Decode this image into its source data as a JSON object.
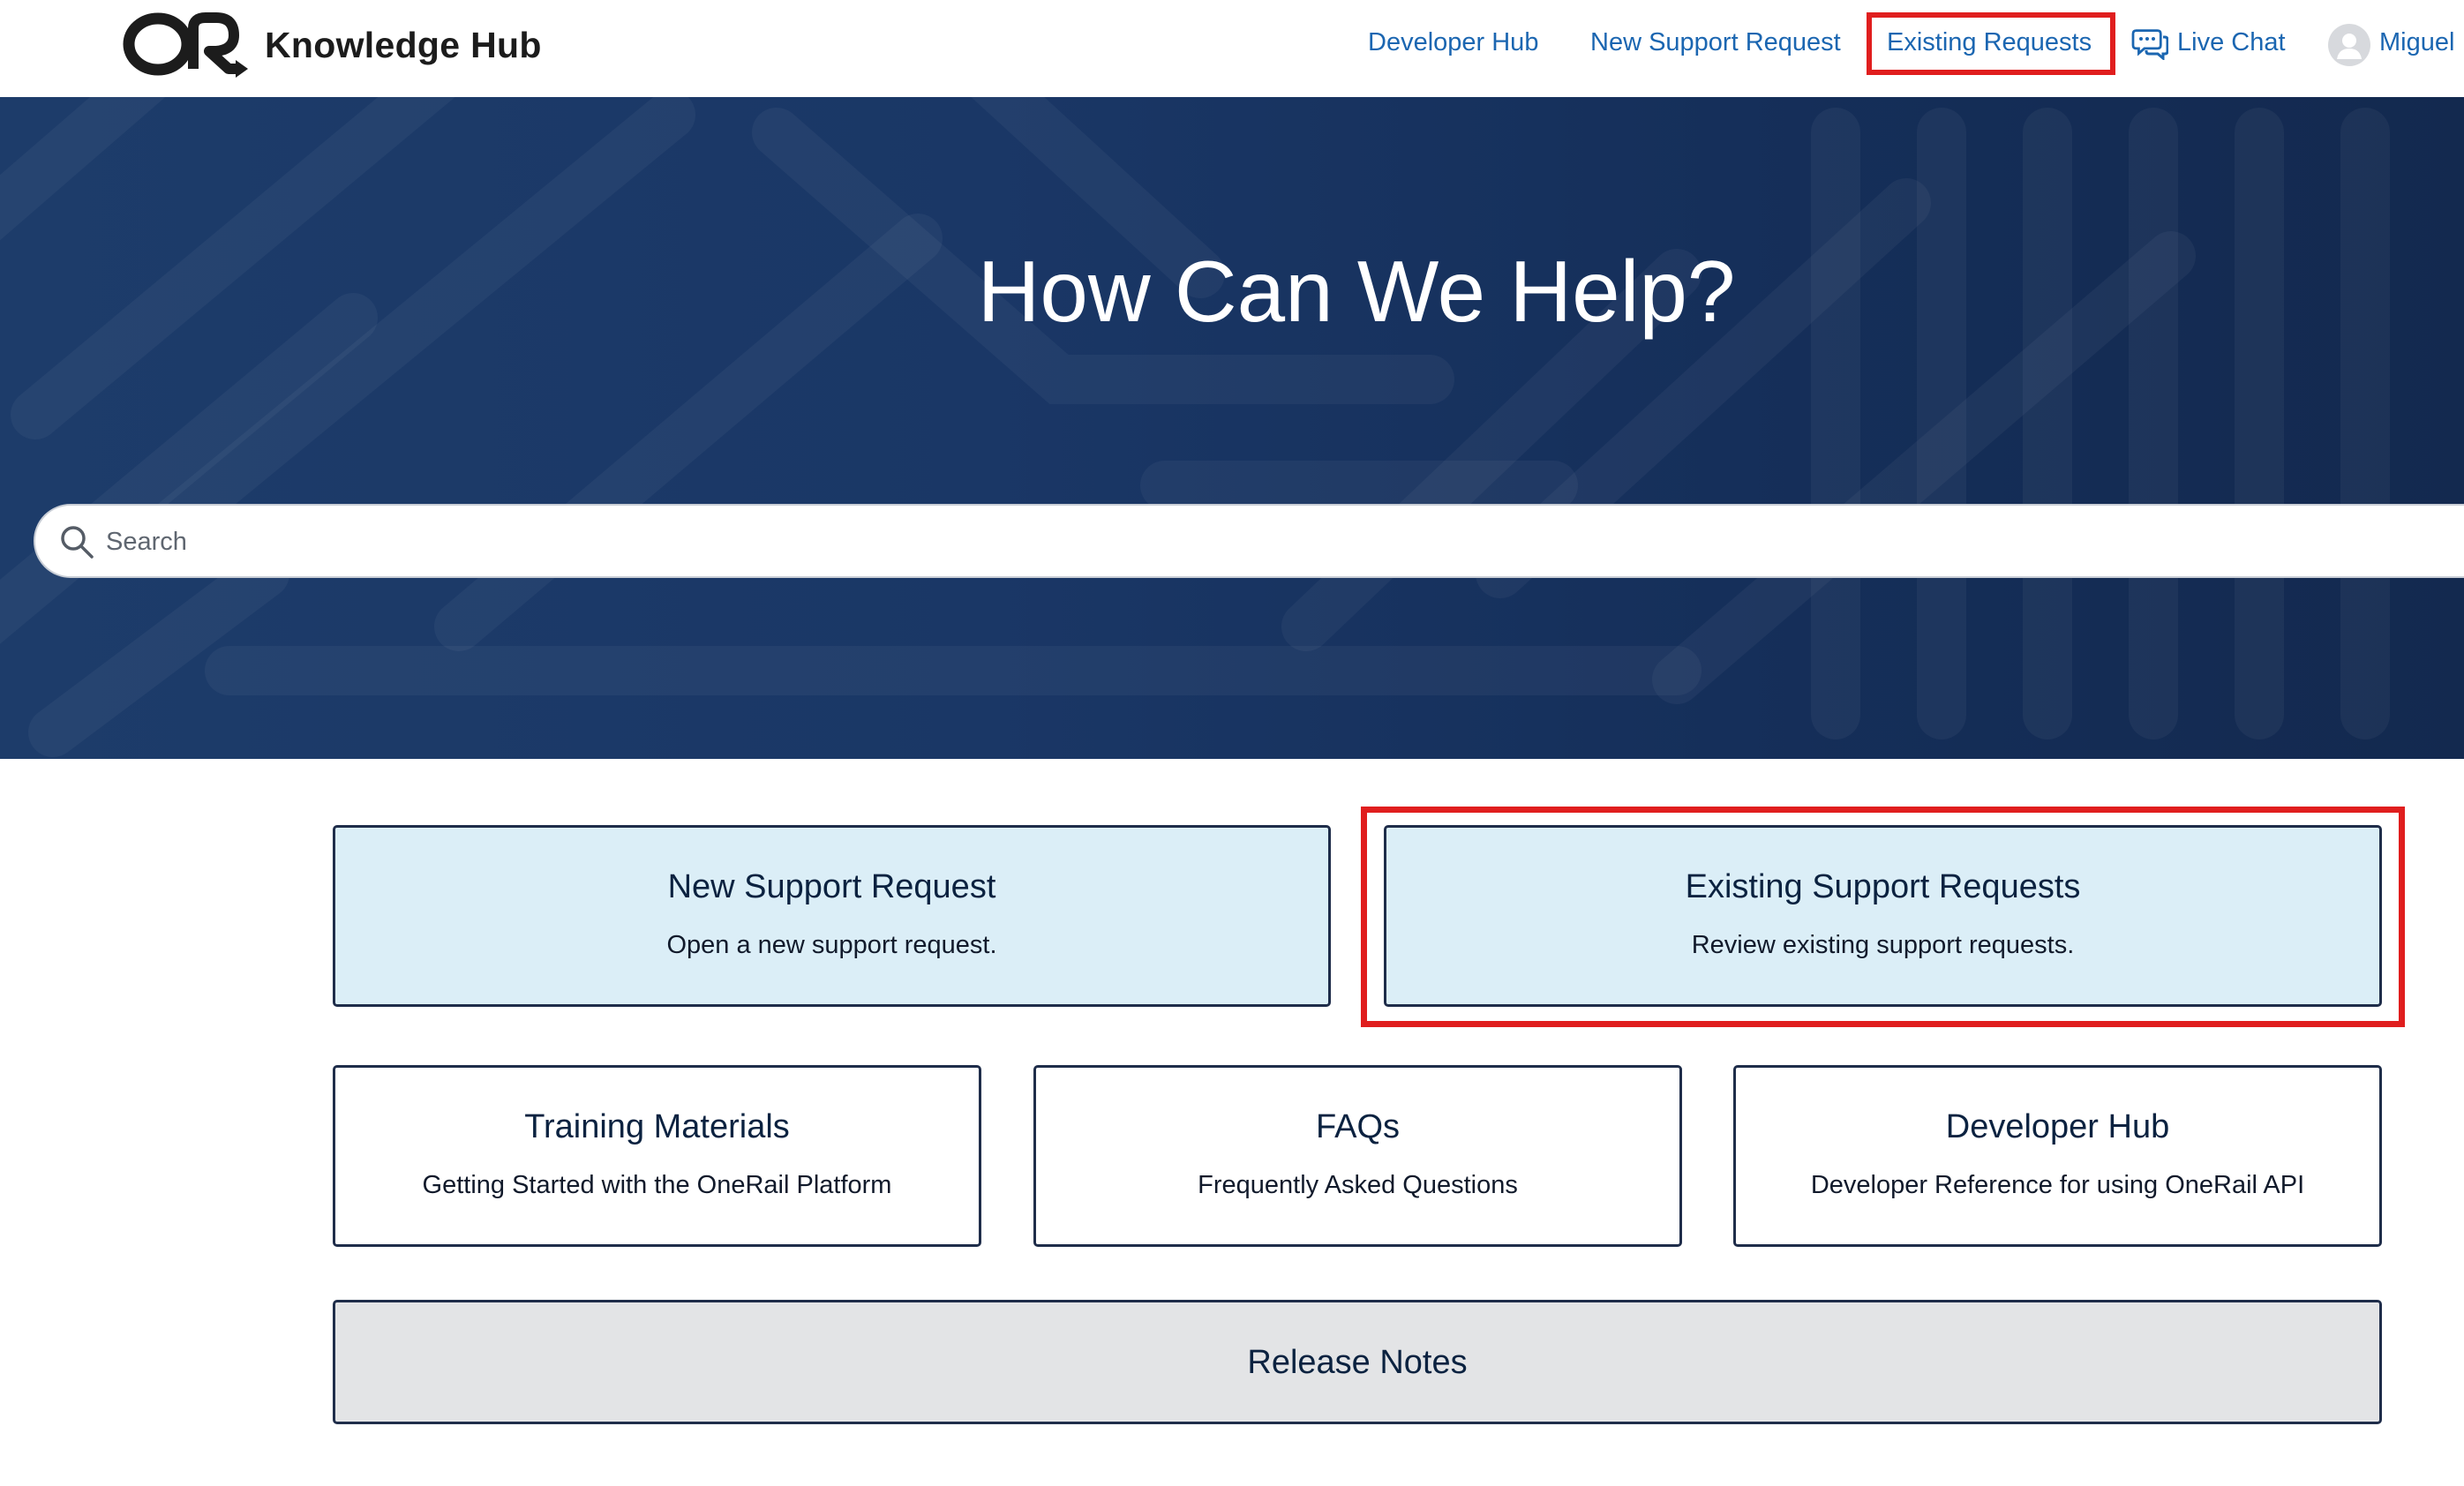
{
  "header": {
    "brand_title": "Knowledge Hub",
    "nav": {
      "developer_hub": "Developer Hub",
      "new_support_request": "New Support Request",
      "existing_requests": "Existing Requests",
      "live_chat": "Live Chat",
      "user_name": "Miguel"
    },
    "icons": {
      "logo": "onerail-logo",
      "chat": "chat-bubbles-icon",
      "avatar": "user-avatar-icon"
    },
    "highlight_color": "#e01e1e"
  },
  "hero": {
    "title": "How Can We Help?",
    "search": {
      "placeholder": "Search",
      "value": ""
    },
    "background_color": "#1a3766"
  },
  "cards": {
    "new_support_request": {
      "title": "New Support Request",
      "description": "Open a new support request."
    },
    "existing_support_requests": {
      "title": "Existing Support Requests",
      "description": "Review existing support requests."
    },
    "training_materials": {
      "title": "Training Materials",
      "description": "Getting Started with the OneRail Platform"
    },
    "faqs": {
      "title": "FAQs",
      "description": "Frequently Asked Questions"
    },
    "developer_hub": {
      "title": "Developer Hub",
      "description": "Developer Reference for using OneRail API"
    },
    "release_notes": {
      "title": "Release Notes"
    }
  },
  "colors": {
    "link": "#1b66b1",
    "card_blue": "#dbeef7",
    "card_grey": "#e3e4e6",
    "card_border": "#1f2d4a",
    "highlight": "#e01e1e"
  }
}
